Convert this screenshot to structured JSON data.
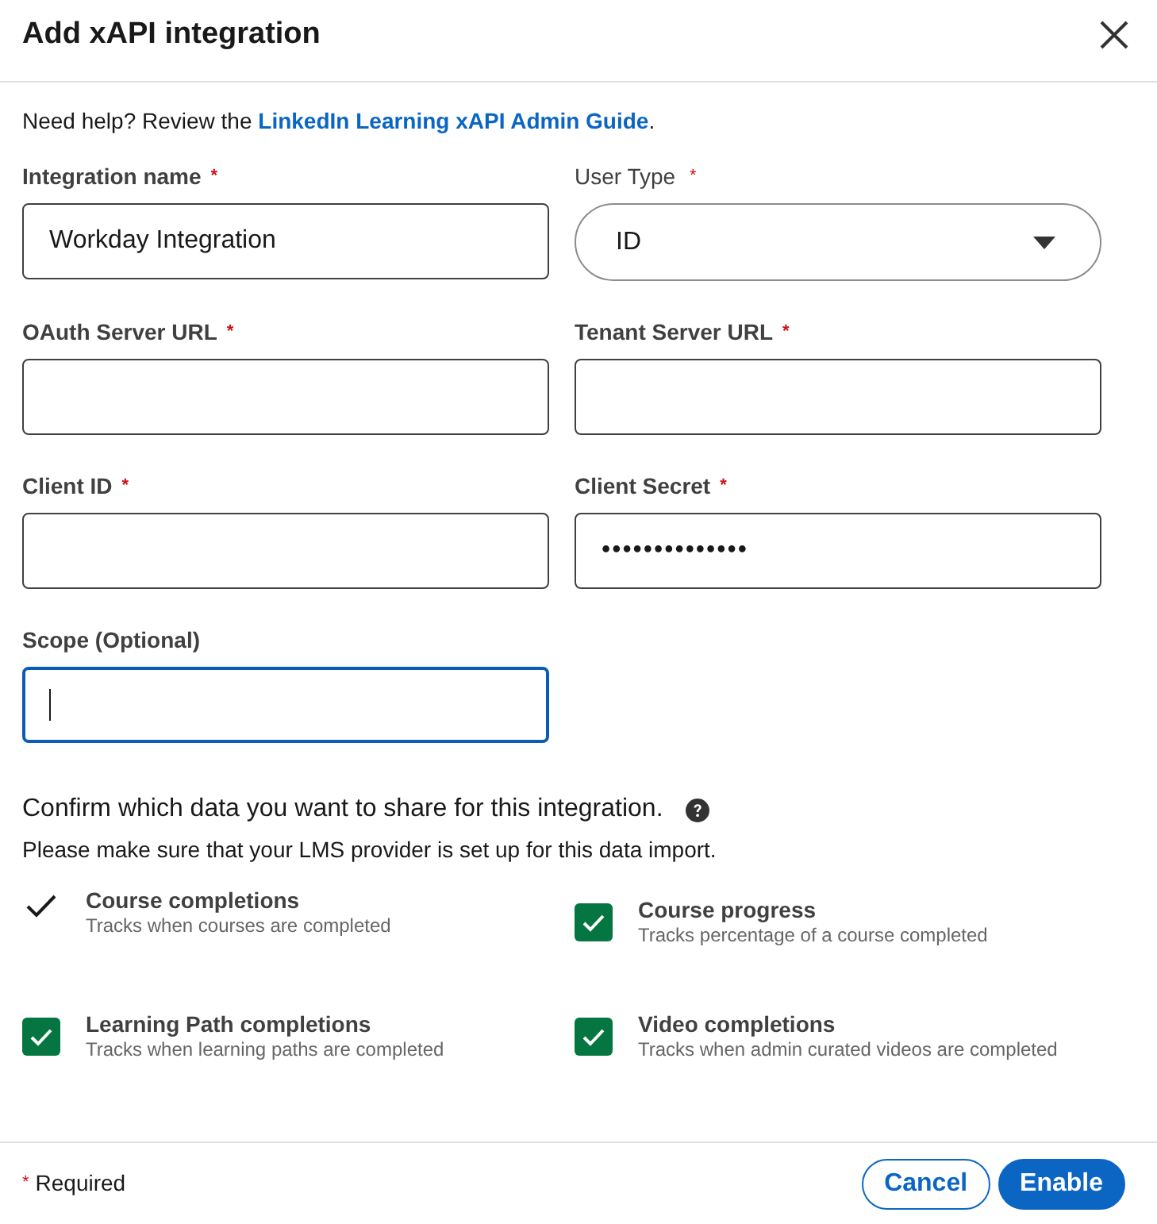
{
  "dialog": {
    "title": "Add xAPI integration"
  },
  "help": {
    "text": "Need help? Review the ",
    "link": "LinkedIn Learning xAPI Admin Guide",
    "suffix": "."
  },
  "fields": [
    {
      "kind": "text",
      "label": "Integration name",
      "mark": "*",
      "value": "Workday Integration"
    },
    {
      "kind": "select",
      "label": "User Type",
      "mark": "*",
      "value": "ID"
    },
    {
      "kind": "text",
      "label": "OAuth Server URL",
      "mark": "*"
    },
    {
      "kind": "text",
      "label": "Tenant Server URL",
      "mark": "*"
    },
    {
      "kind": "text",
      "label": "Client ID",
      "mark": "*"
    },
    {
      "kind": "password",
      "label": "Client Secret",
      "mark": "*",
      "value": "••••••••••••••"
    },
    {
      "kind": "text",
      "label": "Scope (Optional)",
      "focused": true
    }
  ],
  "data_sharing": {
    "heading": "Confirm which data you want to share for this integration.",
    "note": "Please make sure that your LMS provider is set up for this data import.",
    "options": [
      {
        "kind": "fixed",
        "title": "Course completions",
        "description": "Tracks when courses are completed",
        "checked": true
      },
      {
        "kind": "checkbox",
        "title": "Course progress",
        "description": "Tracks percentage of a course completed",
        "checked": true
      },
      {
        "kind": "checkbox",
        "title": "Learning Path completions",
        "description": "Tracks when learning paths are completed",
        "checked": true
      },
      {
        "kind": "checkbox",
        "title": "Video completions",
        "description": "Tracks when admin curated videos are completed",
        "checked": true
      }
    ]
  },
  "footer": {
    "mark": "*",
    "required_note": "Required",
    "buttons": [
      {
        "kind": "secondary",
        "label": "Cancel"
      },
      {
        "kind": "primary",
        "label": "Enable"
      }
    ]
  }
}
